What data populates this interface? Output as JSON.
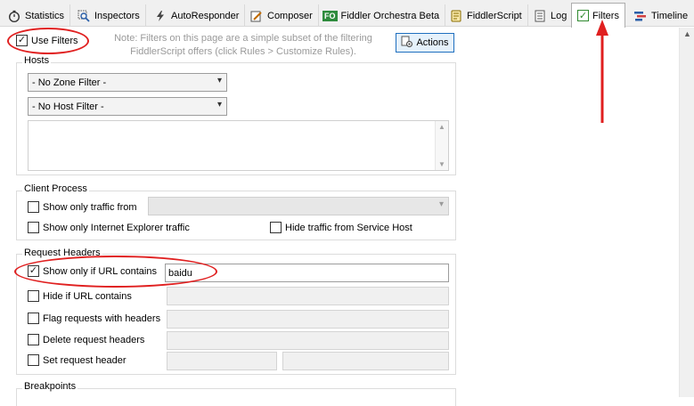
{
  "tabs": [
    {
      "label": "Statistics",
      "icon": "stopwatch-icon"
    },
    {
      "label": "Inspectors",
      "icon": "magnifier-icon"
    },
    {
      "label": "AutoResponder",
      "icon": "lightning-icon"
    },
    {
      "label": "Composer",
      "icon": "pencil-icon"
    },
    {
      "label": "Fiddler Orchestra Beta",
      "icon": "fo-badge-icon",
      "badge": "FO"
    },
    {
      "label": "FiddlerScript",
      "icon": "script-icon"
    },
    {
      "label": "Log",
      "icon": "log-icon"
    },
    {
      "label": "Filters",
      "icon": "check-icon",
      "active": true
    },
    {
      "label": "Timeline",
      "icon": "timeline-icon"
    }
  ],
  "top": {
    "use_filters_label": "Use Filters",
    "use_filters_checked": true,
    "note": "Note: Filters on this page are a simple subset of the filtering FiddlerScript offers (click Rules > Customize Rules).",
    "actions_label": "Actions"
  },
  "hosts": {
    "title": "Hosts",
    "zone_filter": "- No Zone Filter -",
    "host_filter": "- No Host Filter -",
    "hosts_list": ""
  },
  "client_process": {
    "title": "Client Process",
    "show_only_traffic_from": "Show only traffic from",
    "show_only_ie": "Show only Internet Explorer traffic",
    "hide_service_host": "Hide traffic from Service Host"
  },
  "request_headers": {
    "title": "Request Headers",
    "show_only_url_contains": "Show only if URL contains",
    "show_only_url_checked": true,
    "url_value": "baidu",
    "hide_url_contains": "Hide if URL contains",
    "flag_requests": "Flag requests with headers",
    "delete_request_headers": "Delete request headers",
    "set_request_header": "Set request header"
  },
  "breakpoints": {
    "title": "Breakpoints"
  },
  "colors": {
    "annotation": "#e02020",
    "accent_border": "#1f6fbf"
  }
}
